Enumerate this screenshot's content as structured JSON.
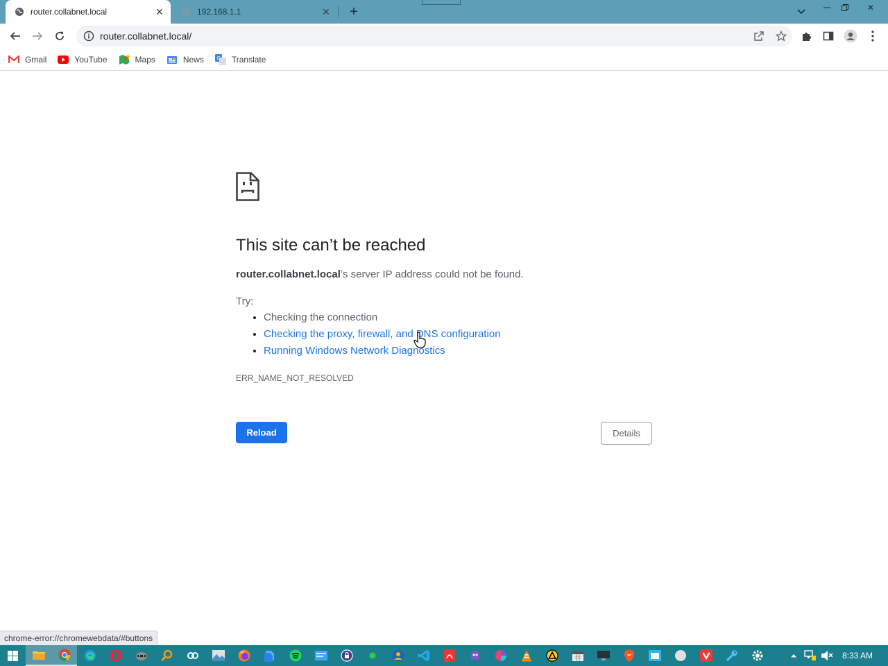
{
  "tabs": [
    {
      "title": "router.collabnet.local",
      "active": true
    },
    {
      "title": "192.168.1.1",
      "active": false
    }
  ],
  "address_bar": {
    "url": "router.collabnet.local/"
  },
  "bookmarks": [
    {
      "label": "Gmail",
      "icon": "gmail-icon"
    },
    {
      "label": "YouTube",
      "icon": "youtube-icon"
    },
    {
      "label": "Maps",
      "icon": "maps-icon"
    },
    {
      "label": "News",
      "icon": "news-icon"
    },
    {
      "label": "Translate",
      "icon": "translate-icon"
    }
  ],
  "error": {
    "title": "This site can’t be reached",
    "host": "router.collabnet.local",
    "summary_rest": "’s server IP address could not be found.",
    "try_label": "Try:",
    "suggestions": [
      "Checking the connection",
      "Checking the proxy, firewall, and DNS configuration",
      "Running Windows Network Diagnostics"
    ],
    "code": "ERR_NAME_NOT_RESOLVED",
    "reload_label": "Reload",
    "details_label": "Details"
  },
  "status_bar": {
    "text": "chrome-error://chromewebdata/#buttons"
  },
  "taskbar": {
    "clock": "8:33 AM"
  },
  "colors": {
    "accent": "#1a73e8",
    "tabstrip": "#5d9fb7",
    "taskbar": "#1b7f8f"
  }
}
